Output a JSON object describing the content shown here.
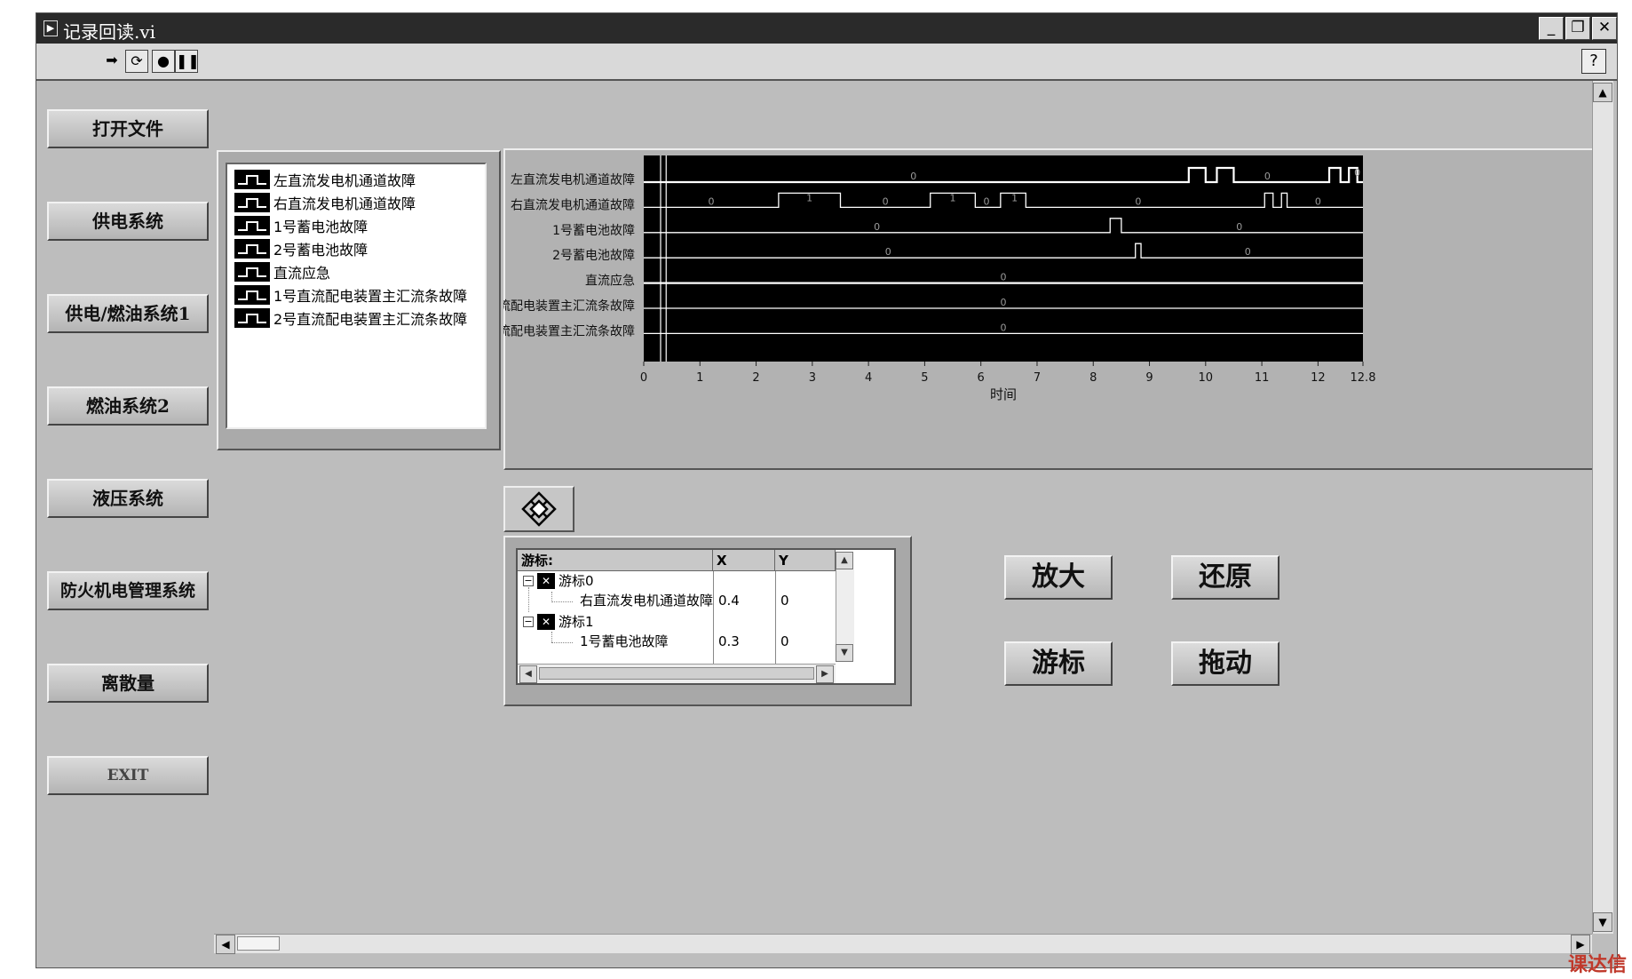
{
  "window": {
    "title": "记录回读.vi"
  },
  "toolbar": {
    "run_icon": "run-arrow-icon",
    "run_continuous_icon": "run-continuously-icon",
    "abort_icon": "abort-icon",
    "pause_icon": "pause-icon",
    "help_label": "?"
  },
  "sidebar": {
    "buttons": [
      {
        "label": "打开文件"
      },
      {
        "label": "供电系统"
      },
      {
        "label": "供电/燃油系统1"
      },
      {
        "label": "燃油系统2"
      },
      {
        "label": "液压系统"
      },
      {
        "label": "防火机电管理系统"
      },
      {
        "label": "离散量"
      },
      {
        "label": "EXIT"
      }
    ]
  },
  "legend": {
    "items": [
      {
        "label": "左直流发电机通道故障"
      },
      {
        "label": "右直流发电机通道故障"
      },
      {
        "label": "1号蓄电池故障"
      },
      {
        "label": "2号蓄电池故障"
      },
      {
        "label": "直流应急"
      },
      {
        "label": "1号直流配电装置主汇流条故障"
      },
      {
        "label": "2号直流配电装置主汇流条故障"
      }
    ]
  },
  "chart_data": {
    "type": "line",
    "xlabel": "时间",
    "xlim": [
      0,
      12.8
    ],
    "xticks": [
      "0",
      "1",
      "2",
      "3",
      "4",
      "5",
      "6",
      "7",
      "8",
      "9",
      "10",
      "11",
      "12",
      "12.8"
    ],
    "background": "#000000",
    "trace_color": "#ffffff",
    "cursor_x": [
      0.3,
      0.4
    ],
    "series": [
      {
        "name": "左直流发电机通道故障",
        "values_label": "0",
        "highs": [
          [
            9.7,
            10.0
          ],
          [
            10.2,
            10.5
          ],
          [
            12.2,
            12.4
          ],
          [
            12.55,
            12.7
          ]
        ],
        "labels": [
          {
            "x": 4.8,
            "t": "0"
          },
          {
            "x": 11.1,
            "t": "0"
          },
          {
            "x": 12.7,
            "t": "0"
          }
        ]
      },
      {
        "name": "右直流发电机通道故障",
        "highs": [
          [
            2.4,
            3.5
          ],
          [
            5.1,
            5.9
          ],
          [
            6.35,
            6.8
          ],
          [
            11.05,
            11.2
          ],
          [
            11.35,
            11.45
          ]
        ],
        "labels": [
          {
            "x": 1.2,
            "t": "0"
          },
          {
            "x": 2.95,
            "t": "1"
          },
          {
            "x": 4.3,
            "t": "0"
          },
          {
            "x": 5.5,
            "t": "1"
          },
          {
            "x": 6.1,
            "t": "0"
          },
          {
            "x": 6.6,
            "t": "1"
          },
          {
            "x": 8.8,
            "t": "0"
          },
          {
            "x": 12.0,
            "t": "0"
          }
        ]
      },
      {
        "name": "1号蓄电池故障",
        "highs": [
          [
            8.3,
            8.5
          ]
        ],
        "labels": [
          {
            "x": 4.15,
            "t": "0"
          },
          {
            "x": 10.6,
            "t": "0"
          }
        ]
      },
      {
        "name": "2号蓄电池故障",
        "highs": [
          [
            8.75,
            8.85
          ]
        ],
        "labels": [
          {
            "x": 4.35,
            "t": "0"
          },
          {
            "x": 10.75,
            "t": "0"
          }
        ]
      },
      {
        "name": "直流应急",
        "highs": [],
        "labels": [
          {
            "x": 6.4,
            "t": "0"
          }
        ]
      },
      {
        "name": "1号直流配电装置主汇流条故障",
        "highs": [],
        "labels": [
          {
            "x": 6.4,
            "t": "0"
          }
        ]
      },
      {
        "name": "2号直流配电装置主汇流条故障",
        "highs": [],
        "labels": [
          {
            "x": 6.4,
            "t": "0"
          }
        ]
      }
    ]
  },
  "cursor_palette": {
    "icon": "cursor-move-icon"
  },
  "cursor_table": {
    "headers": {
      "name": "游标:",
      "x": "X",
      "y": "Y"
    },
    "cursors": [
      {
        "name": "游标0",
        "plot": "右直流发电机通道故障",
        "x": "0.4",
        "y": "0"
      },
      {
        "name": "游标1",
        "plot": "1号蓄电池故障",
        "x": "0.3",
        "y": "0"
      }
    ]
  },
  "actions": {
    "zoom_in": "放大",
    "restore": "还原",
    "cursor": "游标",
    "drag": "拖动"
  },
  "watermark": "课达信"
}
